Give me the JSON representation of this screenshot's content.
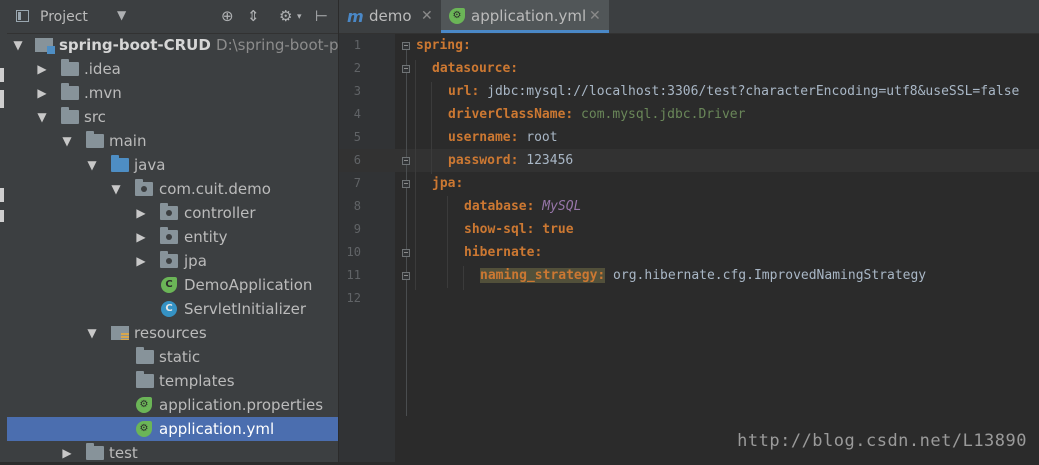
{
  "project_panel": {
    "title": "Project",
    "tree": [
      {
        "label": "spring-boot-CRUD",
        "path": "D:\\spring-boot-pr",
        "expanded": true,
        "icon": "module-folder"
      },
      {
        "label": ".idea",
        "expanded": false,
        "icon": "folder"
      },
      {
        "label": ".mvn",
        "expanded": false,
        "icon": "folder"
      },
      {
        "label": "src",
        "expanded": true,
        "icon": "folder"
      },
      {
        "label": "main",
        "expanded": true,
        "icon": "folder"
      },
      {
        "label": "java",
        "expanded": true,
        "icon": "source-folder"
      },
      {
        "label": "com.cuit.demo",
        "expanded": true,
        "icon": "package"
      },
      {
        "label": "controller",
        "expanded": false,
        "icon": "package"
      },
      {
        "label": "entity",
        "expanded": false,
        "icon": "package"
      },
      {
        "label": "jpa",
        "expanded": false,
        "icon": "package"
      },
      {
        "label": "DemoApplication",
        "icon": "spring-class"
      },
      {
        "label": "ServletInitializer",
        "icon": "class"
      },
      {
        "label": "resources",
        "expanded": true,
        "icon": "resources-folder"
      },
      {
        "label": "static",
        "icon": "folder"
      },
      {
        "label": "templates",
        "icon": "folder"
      },
      {
        "label": "application.properties",
        "icon": "spring-config"
      },
      {
        "label": "application.yml",
        "icon": "spring-config",
        "selected": true
      },
      {
        "label": "test",
        "expanded": false,
        "icon": "folder"
      }
    ]
  },
  "editor": {
    "tabs": [
      {
        "label": "demo",
        "icon": "maven-m-icon",
        "active": false
      },
      {
        "label": "application.yml",
        "icon": "spring-config",
        "active": true
      }
    ],
    "line_numbers": [
      "1",
      "2",
      "3",
      "4",
      "5",
      "6",
      "7",
      "8",
      "9",
      "10",
      "11",
      "12"
    ],
    "code": {
      "l1_key": "spring:",
      "l2_key": "datasource:",
      "l3_key": "url:",
      "l3_val": " jdbc:mysql://localhost:3306/test?characterEncoding=utf8&useSSL=false",
      "l4_key": "driverClassName:",
      "l4_val": " com.mysql.jdbc.Driver",
      "l5_key": "username:",
      "l5_val": " root",
      "l6_key": "password:",
      "l6_val": " 123456",
      "l7_key": "jpa:",
      "l8_key": "database:",
      "l8_val": " MySQL",
      "l9_key": "show-sql:",
      "l9_val": " true",
      "l10_key": "hibernate:",
      "l11_key": "naming_strategy:",
      "l11_val": " org.hibernate.cfg.ImprovedNamingStrategy"
    }
  },
  "watermark": "http://blog.csdn.net/L13890",
  "colors": {
    "selection": "#4b6eaf",
    "yaml_key": "#cc7832",
    "active_tab_underline": "#4a88c7"
  }
}
